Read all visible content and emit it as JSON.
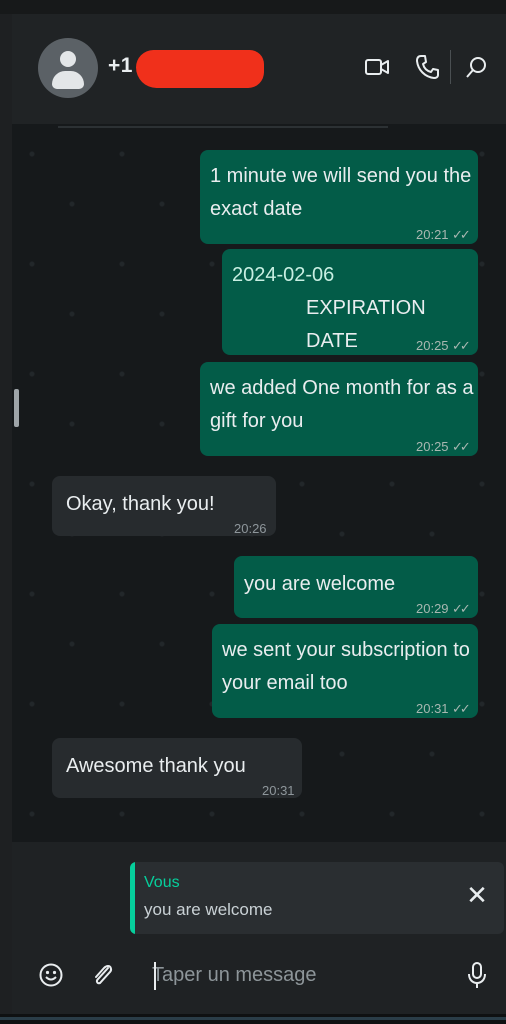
{
  "header": {
    "contact_prefix": "+1 ("
  },
  "messages": [
    {
      "direction": "out",
      "text_lines": [
        "1 minute we will send you the",
        "exact date"
      ],
      "time": "20:21",
      "ticks": "✓✓"
    },
    {
      "direction": "out",
      "text_lines": [
        "2024-02-06",
        "EXPIRATION DATE"
      ],
      "time": "20:25",
      "ticks": "✓✓"
    },
    {
      "direction": "out",
      "text_lines": [
        "we added One month for as a",
        "gift for you"
      ],
      "time": "20:25",
      "ticks": "✓✓"
    },
    {
      "direction": "in",
      "text_lines": [
        "Okay, thank you!"
      ],
      "time": "20:26"
    },
    {
      "direction": "out",
      "text_lines": [
        "you are welcome"
      ],
      "time": "20:29",
      "ticks": "✓✓"
    },
    {
      "direction": "out",
      "text_lines": [
        "we sent your subscription to",
        "your email too"
      ],
      "time": "20:31",
      "ticks": "✓✓"
    },
    {
      "direction": "in",
      "text_lines": [
        "Awesome thank you"
      ],
      "time": "20:31"
    }
  ],
  "reply_preview": {
    "author": "Vous",
    "text": "you are welcome",
    "close_glyph": "✕"
  },
  "composer": {
    "placeholder": "Taper un message"
  },
  "icons": {
    "header": [
      "video-call-icon",
      "voice-call-icon",
      "search-icon"
    ],
    "composer": [
      "emoji-icon",
      "attach-icon",
      "microphone-icon"
    ]
  },
  "colors": {
    "outgoing_bubble": "#035c48",
    "incoming_bubble": "#272b2e",
    "accent": "#06cf9c",
    "redaction": "#f0301b"
  }
}
